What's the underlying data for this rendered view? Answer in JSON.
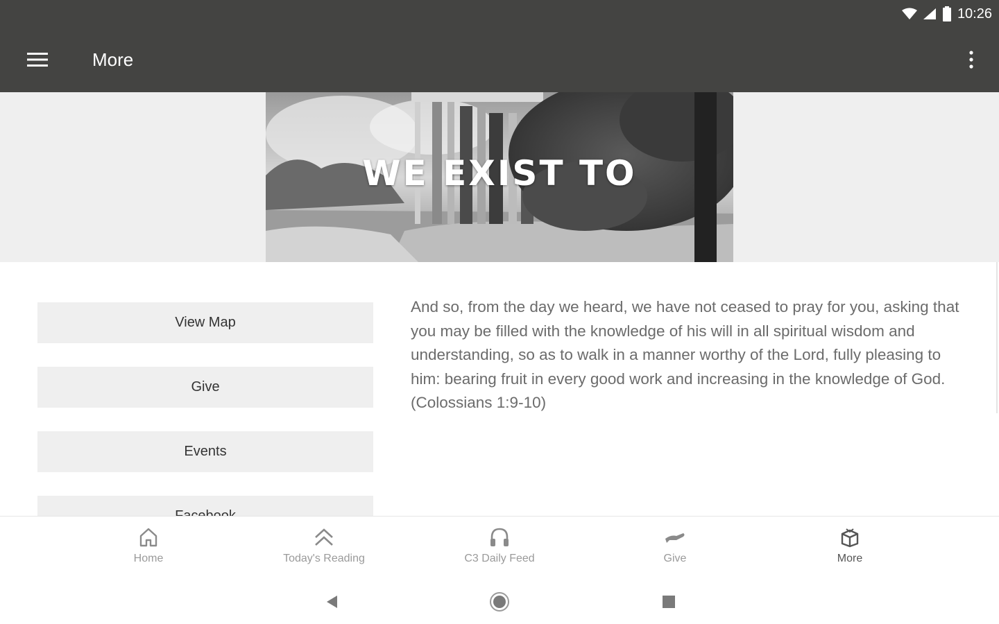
{
  "status_bar": {
    "time": "10:26"
  },
  "app_bar": {
    "title": "More",
    "menu_icon": "hamburger-menu-icon",
    "overflow_icon": "more-vert-icon"
  },
  "banner": {
    "title": "WE EXIST TO"
  },
  "buttons": [
    {
      "label": "View Map"
    },
    {
      "label": "Give"
    },
    {
      "label": "Events"
    },
    {
      "label": "Facebook"
    }
  ],
  "verse": {
    "text": "And so, from the day we heard, we have not ceased to pray for you, asking that you may be filled with the knowledge of his will in all spiritual wisdom and understanding, so as to walk in a manner worthy of the Lord, fully pleasing to him: bearing fruit in every good work and increasing in the knowledge of God. (Colossians 1:9-10)"
  },
  "bottom_nav": {
    "items": [
      {
        "label": "Home",
        "icon": "home-icon",
        "active": false
      },
      {
        "label": "Today's Reading",
        "icon": "double-chevron-up-icon",
        "active": false
      },
      {
        "label": "C3 Daily Feed",
        "icon": "headphones-icon",
        "active": false
      },
      {
        "label": "Give",
        "icon": "giving-hand-icon",
        "active": false
      },
      {
        "label": "More",
        "icon": "box-icon",
        "active": true
      }
    ]
  },
  "system_nav": {
    "icons": [
      "back-icon",
      "home-circle-icon",
      "recents-icon"
    ]
  },
  "colors": {
    "app_bar": "#444442",
    "banner_side": "#efefef",
    "button_bg": "#efefef",
    "verse_text": "#6b6b6b",
    "nav_inactive": "#9a9a9a",
    "nav_active": "#555555"
  }
}
